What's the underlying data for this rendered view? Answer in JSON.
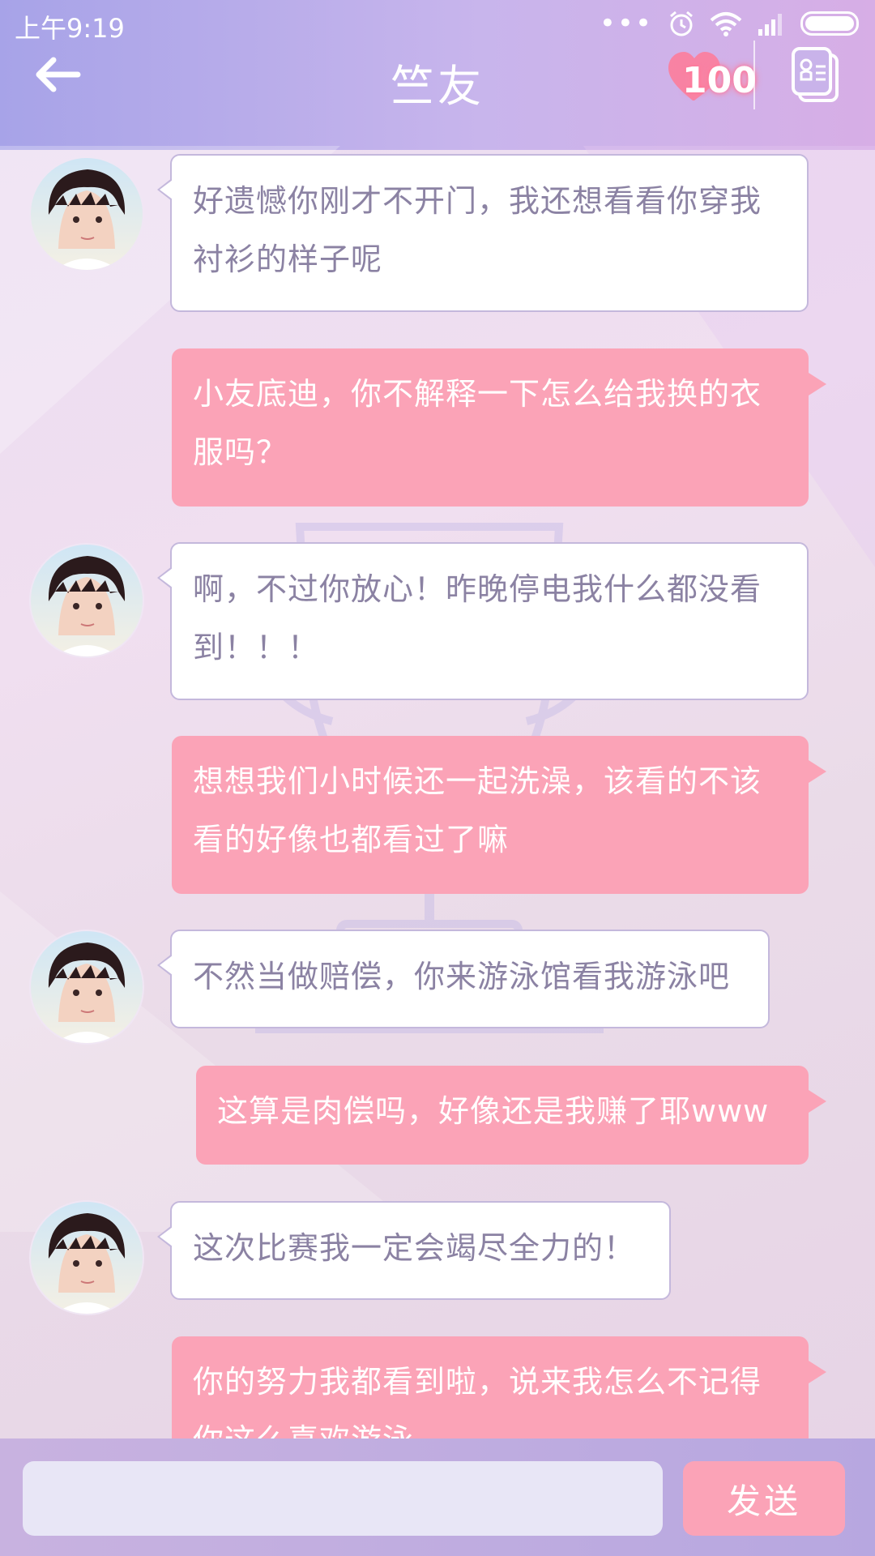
{
  "status_bar": {
    "time": "上午9:19",
    "more_dots": "•••"
  },
  "header": {
    "title": "竺友",
    "affection_count": "100",
    "icons": [
      "back-arrow-icon",
      "heart-icon",
      "contacts-card-icon"
    ]
  },
  "messages": [
    {
      "side": "left",
      "text_line1": "好遗憾你刚才不开门，我还想看看你穿我",
      "text_line2": "衬衫的样子呢"
    },
    {
      "side": "right",
      "text_line1": "小友底迪，你不解释一下怎么给我换的衣",
      "text_line2": "服吗？"
    },
    {
      "side": "left",
      "text_line1": "啊，不过你放心！昨晚停电我什么都没看",
      "text_line2": "到！！！"
    },
    {
      "side": "right",
      "text_line1": "想想我们小时候还一起洗澡，该看的不该",
      "text_line2": "看的好像也都看过了嘛"
    },
    {
      "side": "left",
      "text_line1": "不然当做赔偿，你来游泳馆看我游泳吧"
    },
    {
      "side": "right",
      "text_line1": "这算是肉偿吗，好像还是我赚了耶www"
    },
    {
      "side": "left",
      "text_line1": "这次比赛我一定会竭尽全力的！"
    },
    {
      "side": "right",
      "text_line1": "你的努力我都看到啦，说来我怎么不记得",
      "text_line2": "你这么喜欢游泳"
    }
  ],
  "input_bar": {
    "input_value": "",
    "send_label": "发送"
  },
  "colors": {
    "header_start": "#a7a3e8",
    "header_end": "#d7aee6",
    "bubble_right": "#fba3b7",
    "bubble_left_text": "#8b82a3",
    "bubble_left_border": "#c4b8dc"
  }
}
